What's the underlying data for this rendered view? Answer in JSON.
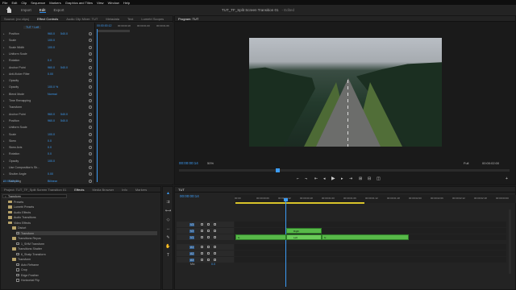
{
  "menu": [
    "File",
    "Edit",
    "Clip",
    "Sequence",
    "Markers",
    "Graphics and Titles",
    "View",
    "Window",
    "Help"
  ],
  "workspace_tabs": [
    "Import",
    "Edit",
    "Export"
  ],
  "active_workspace": "Edit",
  "document": {
    "title": "TUT_TF_Split Screen Transition 01",
    "status": "- Edited"
  },
  "source_tabs": [
    "Source: (no clips)",
    "Effect Controls",
    "Audio Clip Mixer: TUT",
    "Metadata",
    "Text",
    "Lumetri Scopes"
  ],
  "effect_controls": {
    "clip_header": "TUT * Left",
    "timecodes": [
      "00:00:00:12",
      "00:00:00:18",
      "00:00:01:00",
      "00:00:01:06",
      "00:00:01:12"
    ],
    "head_time": "00:00:00:12",
    "bottom_timecode": "00:00:00:14",
    "rows": [
      {
        "label": "Position",
        "v1": "960.0",
        "v2": "540.0"
      },
      {
        "label": "Scale",
        "v1": "100.0",
        "v2": ""
      },
      {
        "label": "Scale Width",
        "v1": "100.0",
        "v2": ""
      },
      {
        "label": "Uniform Scale",
        "v1": "",
        "v2": ""
      },
      {
        "label": "Rotation",
        "v1": "0.0",
        "v2": ""
      },
      {
        "label": "Anchor Point",
        "v1": "960.0",
        "v2": "540.0"
      },
      {
        "label": "Anti-flicker Filter",
        "v1": "0.00",
        "v2": ""
      },
      {
        "label": "Opacity",
        "v1": "",
        "v2": ""
      },
      {
        "label": "Opacity",
        "v1": "100.0 %",
        "v2": ""
      },
      {
        "label": "Blend Mode",
        "v1": "Normal",
        "v2": ""
      },
      {
        "label": "Time Remapping",
        "v1": "",
        "v2": ""
      },
      {
        "label": "Transform",
        "v1": "",
        "v2": ""
      },
      {
        "label": "Anchor Point",
        "v1": "960.0",
        "v2": "540.0"
      },
      {
        "label": "Position",
        "v1": "960.0",
        "v2": "540.0"
      },
      {
        "label": "Uniform Scale",
        "v1": "",
        "v2": ""
      },
      {
        "label": "Scale",
        "v1": "100.0",
        "v2": ""
      },
      {
        "label": "Skew",
        "v1": "0.0",
        "v2": ""
      },
      {
        "label": "Skew Axis",
        "v1": "0.0",
        "v2": ""
      },
      {
        "label": "Rotation",
        "v1": "0.0",
        "v2": ""
      },
      {
        "label": "Opacity",
        "v1": "100.0",
        "v2": ""
      },
      {
        "label": "Use Composition's Sh...",
        "v1": "",
        "v2": ""
      },
      {
        "label": "Shutter Angle",
        "v1": "0.00",
        "v2": ""
      },
      {
        "label": "Sampling",
        "v1": "Bilinear",
        "v2": ""
      }
    ]
  },
  "program": {
    "title": "Program: TUT",
    "timecode": "00:00:00:14",
    "zoom": "50%",
    "quality": "Full",
    "duration": "00:00:02:00"
  },
  "project_tabs": [
    "Project: TUT_TF_Split Screen Transition 01",
    "Effects",
    "Media Browser",
    "Info",
    "Markers"
  ],
  "search_placeholder": "Transform",
  "effects_tree": [
    {
      "label": "Presets",
      "indent": 1,
      "icon": "folder"
    },
    {
      "label": "Lumetri Presets",
      "indent": 1,
      "icon": "folder"
    },
    {
      "label": "Audio Effects",
      "indent": 1,
      "icon": "folder"
    },
    {
      "label": "Audio Transitions",
      "indent": 1,
      "icon": "folder"
    },
    {
      "label": "Video Effects",
      "indent": 1,
      "icon": "folder"
    },
    {
      "label": "Distort",
      "indent": 2,
      "icon": "folder"
    },
    {
      "label": "Transform",
      "indent": 3,
      "icon": "fx",
      "selected": true
    },
    {
      "label": "Transitions Reyus",
      "indent": 2,
      "icon": "folder"
    },
    {
      "label": "1_SHM Transform",
      "indent": 3,
      "icon": "fx"
    },
    {
      "label": "Transitions Shatter",
      "indent": 2,
      "icon": "folder"
    },
    {
      "label": "6_Shatp Transform",
      "indent": 3,
      "icon": "fx"
    },
    {
      "label": "Transform",
      "indent": 2,
      "icon": "folder"
    },
    {
      "label": "Auto Reframe",
      "indent": 3,
      "icon": "fx"
    },
    {
      "label": "Crop",
      "indent": 3,
      "icon": "fx"
    },
    {
      "label": "Edge Feather",
      "indent": 3,
      "icon": "fx"
    },
    {
      "label": "Horizontal Flip",
      "indent": 3,
      "icon": "fx"
    }
  ],
  "timeline": {
    "tab": "TUT",
    "timecode": "00:00:00:14",
    "ruler": [
      "00:00",
      "00:00:00:06",
      "00:00:00:12",
      "00:00:00:18",
      "00:00:01:00",
      "00:00:01:06",
      "00:00:01:12",
      "00:00:01:18",
      "00:00:02:00",
      "00:00:02:06",
      "00:00:02:12",
      "00:00:02:18",
      "00:00:03:00"
    ],
    "tracks": [
      {
        "name": "V3"
      },
      {
        "name": "V2"
      },
      {
        "name": "V1"
      },
      {
        "name": "A1"
      },
      {
        "name": "A2"
      },
      {
        "name": "A3"
      }
    ],
    "clips": [
      {
        "label": "Right"
      },
      {
        "label": "Left"
      },
      {
        "label": "fx"
      },
      {
        "label": "fx"
      }
    ],
    "mix_label": "Mix",
    "mix_value": "0.0"
  }
}
